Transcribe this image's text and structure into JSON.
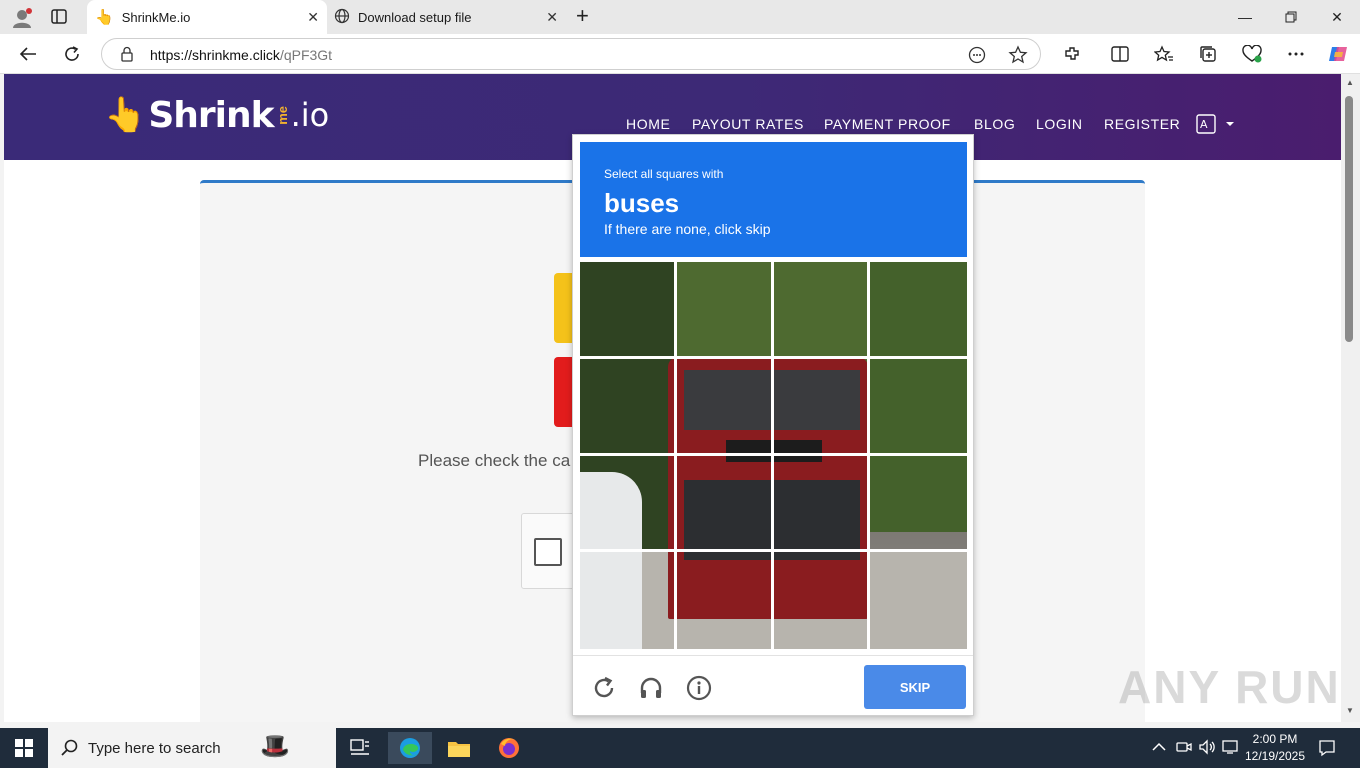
{
  "browser": {
    "tabs": [
      {
        "label": "ShrinkMe.io",
        "active": true
      },
      {
        "label": "Download setup file",
        "active": false
      }
    ],
    "url_host": "https://shrinkme.click",
    "url_path": "/qPF3Gt",
    "new_tab_symbol": "+",
    "close_symbol": "✕"
  },
  "site": {
    "logo_main": "Shrink",
    "logo_me": "me",
    "logo_io": ".io",
    "nav": [
      "HOME",
      "PAYOUT RATES",
      "PAYMENT PROOF",
      "BLOG",
      "LOGIN",
      "REGISTER"
    ],
    "check_text": "Please check the ca",
    "brand_colors": {
      "header": "#3d2976",
      "accent": "#2f7ac8"
    }
  },
  "captcha": {
    "instruction": "Select all squares with",
    "target": "buses",
    "subtext": "If there are none, click skip",
    "skip_label": "SKIP",
    "grid_size": "4x4",
    "header_color": "#1a73e8"
  },
  "watermark": "ANY RUN",
  "taskbar": {
    "search_placeholder": "Type here to search",
    "time": "2:00 PM",
    "date": "12/19/2025"
  }
}
